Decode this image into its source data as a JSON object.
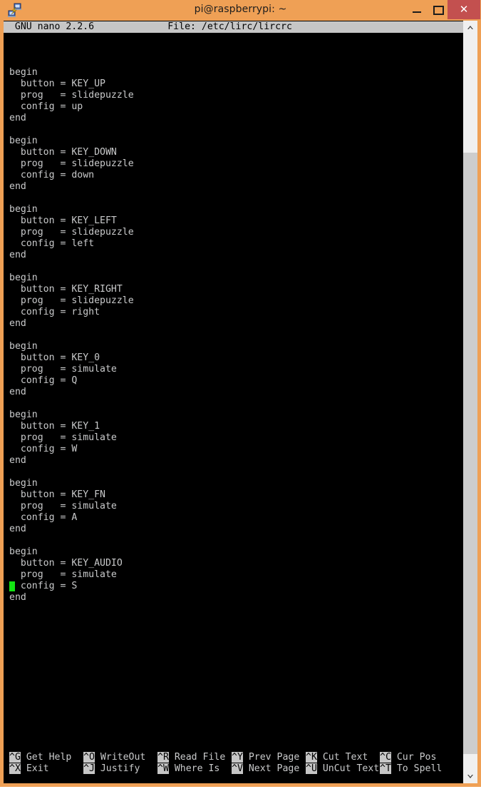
{
  "window": {
    "title": "pi@raspberrypi: ~",
    "app_icon": "putty-icon",
    "frame_color": "#efa055",
    "controls": {
      "minimize": "–",
      "maximize": "□",
      "close": "✕"
    }
  },
  "nano": {
    "version_label": "GNU nano 2.2.6",
    "file_label": "File: /etc/lirc/lircrc",
    "header_line": "  GNU nano 2.2.6             File: /etc/lirc/lircrc",
    "cursor": {
      "line": 41,
      "column": 1,
      "color": "#12e412"
    },
    "lines": [
      "",
      "begin",
      "  button = KEY_UP",
      "  prog   = slidepuzzle",
      "  config = up",
      "end",
      "",
      "begin",
      "  button = KEY_DOWN",
      "  prog   = slidepuzzle",
      "  config = down",
      "end",
      "",
      "begin",
      "  button = KEY_LEFT",
      "  prog   = slidepuzzle",
      "  config = left",
      "end",
      "",
      "begin",
      "  button = KEY_RIGHT",
      "  prog   = slidepuzzle",
      "  config = right",
      "end",
      "",
      "begin",
      "  button = KEY_0",
      "  prog   = simulate",
      "  config = Q",
      "end",
      "",
      "begin",
      "  button = KEY_1",
      "  prog   = simulate",
      "  config = W",
      "end",
      "",
      "begin",
      "  button = KEY_FN",
      "  prog   = simulate",
      "  config = A",
      "end",
      "",
      "begin",
      "  button = KEY_AUDIO",
      "  prog   = simulate",
      "  config = S",
      "end",
      ""
    ],
    "shortcuts_row1": [
      {
        "key": "^G",
        "label": " Get Help"
      },
      {
        "key": "^O",
        "label": " WriteOut"
      },
      {
        "key": "^R",
        "label": " Read File"
      },
      {
        "key": "^Y",
        "label": " Prev Page"
      },
      {
        "key": "^K",
        "label": " Cut Text"
      },
      {
        "key": "^C",
        "label": " Cur Pos"
      }
    ],
    "shortcuts_row2": [
      {
        "key": "^X",
        "label": " Exit"
      },
      {
        "key": "^J",
        "label": " Justify"
      },
      {
        "key": "^W",
        "label": " Where Is"
      },
      {
        "key": "^V",
        "label": " Next Page"
      },
      {
        "key": "^U",
        "label": " UnCut Text"
      },
      {
        "key": "^T",
        "label": " To Spell"
      }
    ]
  },
  "scrollbar": {
    "up_arrow": "ⱏ",
    "down_arrow": "ⱟ",
    "thumb_top_pct": 16,
    "thumb_height_pct": 82
  }
}
